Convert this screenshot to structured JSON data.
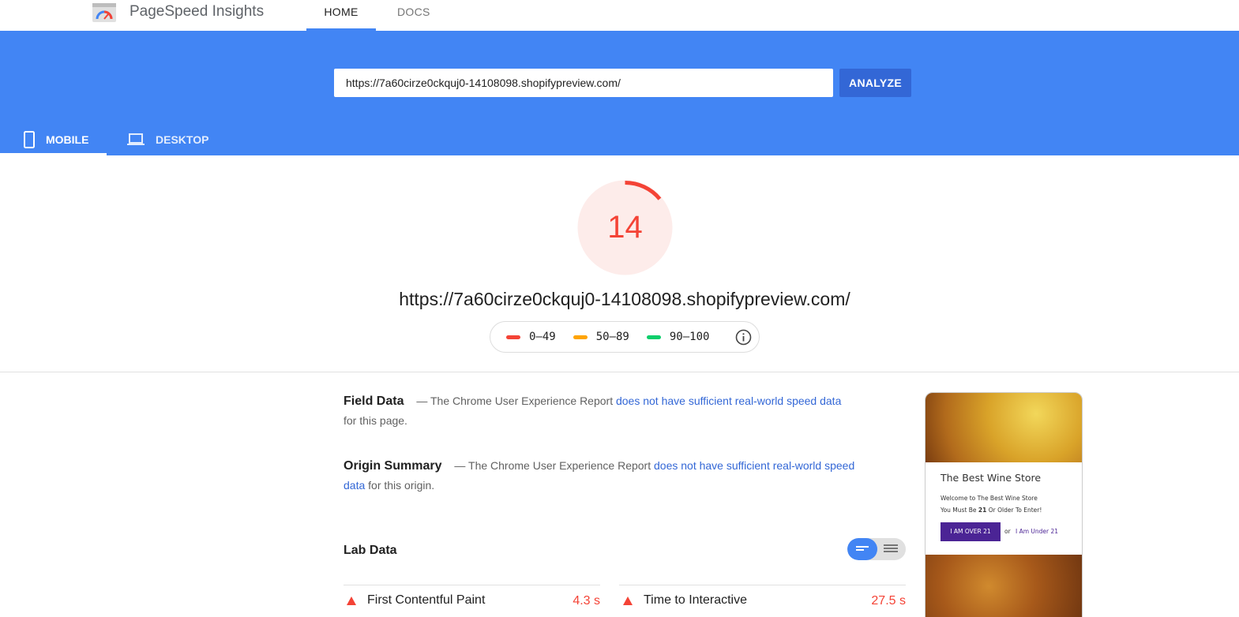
{
  "app": {
    "title": "PageSpeed Insights"
  },
  "nav": {
    "home": "HOME",
    "docs": "DOCS"
  },
  "search": {
    "value": "https://7a60cirze0ckquj0-14108098.shopifypreview.com/",
    "analyze_label": "ANALYZE"
  },
  "device_tabs": {
    "mobile": "MOBILE",
    "desktop": "DESKTOP"
  },
  "score": {
    "value": "14",
    "fraction": 0.14,
    "color": "#f44336"
  },
  "tested_url": "https://7a60cirze0ckquj0-14108098.shopifypreview.com/",
  "legend": [
    {
      "label": "0–49",
      "color": "#f44336"
    },
    {
      "label": "50–89",
      "color": "#ffa400"
    },
    {
      "label": "90–100",
      "color": "#0cce6b"
    }
  ],
  "field_data": {
    "heading": "Field Data",
    "prefix": "— The Chrome User Experience Report",
    "link": "does not have sufficient real-world speed data",
    "suffix": "for this page."
  },
  "origin_summary": {
    "heading": "Origin Summary",
    "prefix": "— The Chrome User Experience Report",
    "link": "does not have sufficient real-world speed data",
    "suffix": "for this origin."
  },
  "lab_data": {
    "heading": "Lab Data"
  },
  "metrics": [
    {
      "label": "First Contentful Paint",
      "value": "4.3 s"
    },
    {
      "label": "Time to Interactive",
      "value": "27.5 s"
    }
  ],
  "preview": {
    "title": "The Best Wine Store",
    "line1": "Welcome to The Best Wine Store",
    "line2_prefix": "You Must Be ",
    "line2_bold": "21",
    "line2_suffix": " Or Older To Enter!",
    "button": "I AM OVER 21",
    "or": "or",
    "link": "I Am Under 21"
  }
}
